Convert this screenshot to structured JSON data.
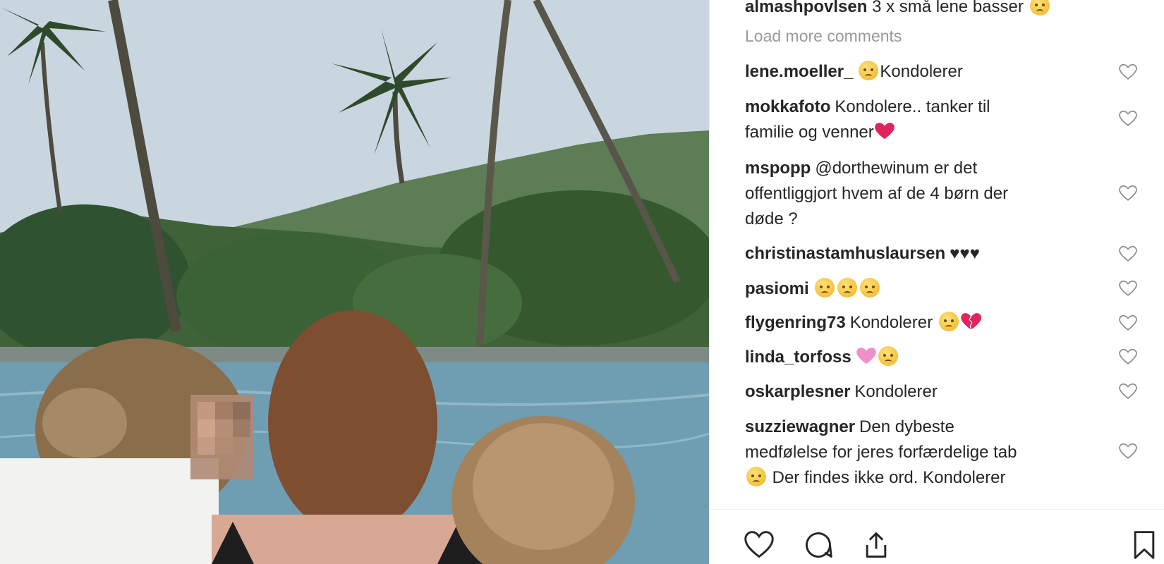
{
  "post": {
    "cut_comment": {
      "username": "almashpovlsen",
      "text": "3 x små lene basser"
    },
    "load_more_label": "Load more comments",
    "comments": [
      {
        "username": "lene.moeller_",
        "text": "Kondolerer",
        "emoji_before": "sad-face"
      },
      {
        "username": "mokkafoto",
        "line1": "Kondolere.. tanker til",
        "line2": "familie og venner",
        "emoji_after": "red-heart"
      },
      {
        "username": "mspopp",
        "line1": "@dorthewinum er det",
        "line2": "offentliggjort hvem af de 4 børn der",
        "line3": "døde ?"
      },
      {
        "username": "christinastamhuslaursen",
        "text": "♥♥♥"
      },
      {
        "username": "pasiomi",
        "text": "",
        "emoji": "sad-face x3"
      },
      {
        "username": "flygenring73",
        "text": "Kondolerer",
        "emoji_after": "sad-face, broken-heart"
      },
      {
        "username": "linda_torfoss",
        "text": "",
        "emoji": "sparkling-heart, sad-face"
      },
      {
        "username": "oskarplesner",
        "text": "Kondolerer"
      },
      {
        "username": "suzziewagner",
        "line1": "Den dybeste",
        "line2": "medfølelse for jeres forfærdelige tab",
        "line3": "Der findes ikke ord. Kondolerer"
      }
    ]
  },
  "colors": {
    "username": "#262626",
    "muted": "#999999",
    "heart_red": "#e0245e",
    "icon": "#262626"
  },
  "icons": [
    "heart-icon",
    "comment-icon",
    "share-icon",
    "bookmark-icon",
    "like-heart-icon"
  ]
}
